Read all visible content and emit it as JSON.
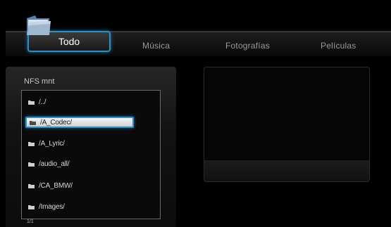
{
  "menu": {
    "tabs": [
      {
        "label": "Todo",
        "selected": true
      },
      {
        "label": "Música",
        "selected": false
      },
      {
        "label": "Fotografías",
        "selected": false
      },
      {
        "label": "Películas",
        "selected": false
      }
    ]
  },
  "browser": {
    "source_title": "NFS mnt",
    "items": [
      {
        "name": "/../",
        "icon": "folder-icon",
        "selected": false
      },
      {
        "name": "/A_Codec/",
        "icon": "folder-icon",
        "selected": true
      },
      {
        "name": "/A_Lyric/",
        "icon": "folder-icon",
        "selected": false
      },
      {
        "name": "/audio_all/",
        "icon": "folder-icon",
        "selected": false
      },
      {
        "name": "/CA_BMW/",
        "icon": "folder-icon",
        "selected": false
      },
      {
        "name": "/Images/",
        "icon": "folder-icon",
        "selected": false
      }
    ],
    "page_indicator": "1/1"
  },
  "colors": {
    "accent": "#2d8fc7",
    "background": "#000000"
  }
}
